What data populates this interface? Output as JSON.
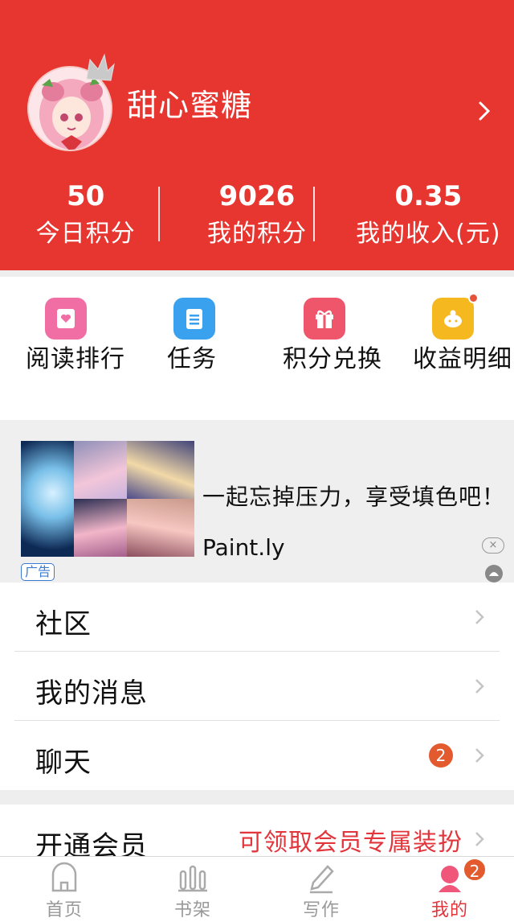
{
  "profile": {
    "username": "甜心蜜糖"
  },
  "stats": [
    {
      "value": "50",
      "label": "今日积分"
    },
    {
      "value": "9026",
      "label": "我的积分"
    },
    {
      "value": "0.35",
      "label": "我的收入(元)"
    }
  ],
  "actions": [
    {
      "label": "阅读排行",
      "icon": "reading-rank-icon",
      "color": "#f06ea3"
    },
    {
      "label": "任务",
      "icon": "task-list-icon",
      "color": "#3aa1ef"
    },
    {
      "label": "积分兑换",
      "icon": "gift-icon",
      "color": "#f0566b"
    },
    {
      "label": "收益明细",
      "icon": "piggy-bank-icon",
      "color": "#f5b81f",
      "has_dot": true
    }
  ],
  "ad": {
    "title": "一起忘掉压力，享受填色吧！",
    "brand": "Paint.ly",
    "tag": "广告",
    "close": "×"
  },
  "menu": [
    {
      "label": "社区"
    },
    {
      "label": "我的消息"
    },
    {
      "label": "聊天",
      "badge": "2"
    }
  ],
  "vip": {
    "label": "开通会员",
    "promo": "可领取会员专属装扮"
  },
  "tabs": [
    {
      "label": "首页",
      "icon": "home-icon"
    },
    {
      "label": "书架",
      "icon": "bookshelf-icon"
    },
    {
      "label": "写作",
      "icon": "pen-icon"
    },
    {
      "label": "我的",
      "icon": "profile-icon",
      "active": true,
      "badge": "2"
    }
  ],
  "colors": {
    "header_bg": "#e73530",
    "accent": "#e2353c",
    "badge": "#e25a2e"
  }
}
